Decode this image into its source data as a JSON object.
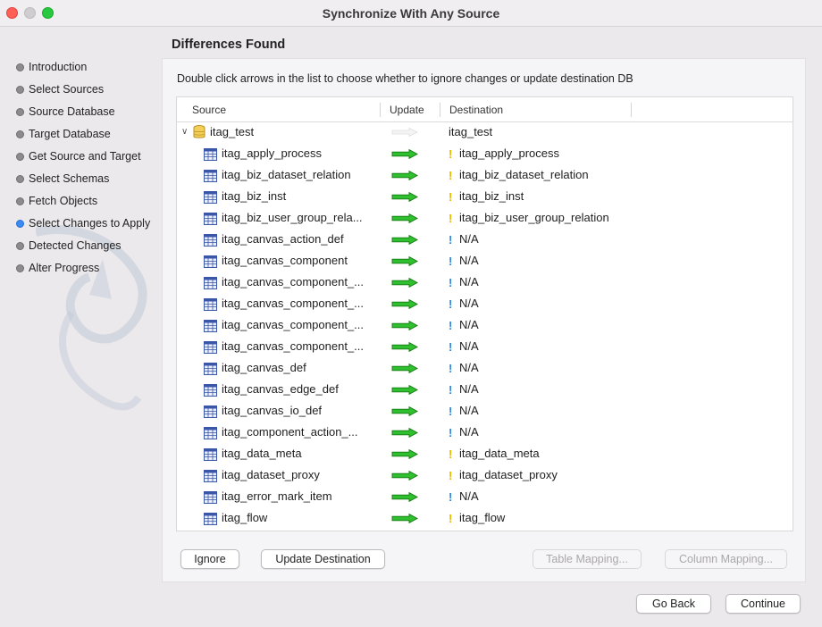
{
  "window": {
    "title": "Synchronize With Any Source"
  },
  "sidebar": {
    "steps": [
      {
        "label": "Introduction",
        "active": false
      },
      {
        "label": "Select Sources",
        "active": false
      },
      {
        "label": "Source Database",
        "active": false
      },
      {
        "label": "Target Database",
        "active": false
      },
      {
        "label": "Get Source and Target",
        "active": false
      },
      {
        "label": "Select Schemas",
        "active": false
      },
      {
        "label": "Fetch Objects",
        "active": false
      },
      {
        "label": "Select Changes to Apply",
        "active": true
      },
      {
        "label": "Detected Changes",
        "active": false
      },
      {
        "label": "Alter Progress",
        "active": false
      }
    ]
  },
  "main": {
    "heading": "Differences Found",
    "instruction": "Double click arrows in the list to choose whether to ignore changes or update destination DB",
    "columns": {
      "source": "Source",
      "update": "Update",
      "destination": "Destination"
    },
    "schema": {
      "source": "itag_test",
      "destination": "itag_test"
    },
    "rows": [
      {
        "source": "itag_apply_process",
        "status": "warn",
        "destination": "itag_apply_process"
      },
      {
        "source": "itag_biz_dataset_relation",
        "status": "warn",
        "destination": "itag_biz_dataset_relation"
      },
      {
        "source": "itag_biz_inst",
        "status": "warn",
        "destination": "itag_biz_inst"
      },
      {
        "source": "itag_biz_user_group_rela...",
        "status": "warn",
        "destination": "itag_biz_user_group_relation"
      },
      {
        "source": "itag_canvas_action_def",
        "status": "info",
        "destination": "N/A"
      },
      {
        "source": "itag_canvas_component",
        "status": "info",
        "destination": "N/A"
      },
      {
        "source": "itag_canvas_component_...",
        "status": "info",
        "destination": "N/A"
      },
      {
        "source": "itag_canvas_component_...",
        "status": "info",
        "destination": "N/A"
      },
      {
        "source": "itag_canvas_component_...",
        "status": "info",
        "destination": "N/A"
      },
      {
        "source": "itag_canvas_component_...",
        "status": "info",
        "destination": "N/A"
      },
      {
        "source": "itag_canvas_def",
        "status": "info",
        "destination": "N/A"
      },
      {
        "source": "itag_canvas_edge_def",
        "status": "info",
        "destination": "N/A"
      },
      {
        "source": "itag_canvas_io_def",
        "status": "info",
        "destination": "N/A"
      },
      {
        "source": "itag_component_action_...",
        "status": "info",
        "destination": "N/A"
      },
      {
        "source": "itag_data_meta",
        "status": "warn",
        "destination": "itag_data_meta"
      },
      {
        "source": "itag_dataset_proxy",
        "status": "warn",
        "destination": "itag_dataset_proxy"
      },
      {
        "source": "itag_error_mark_item",
        "status": "info",
        "destination": "N/A"
      },
      {
        "source": "itag_flow",
        "status": "warn",
        "destination": "itag_flow"
      }
    ],
    "buttons": {
      "ignore": "Ignore",
      "update_destination": "Update Destination",
      "table_mapping": "Table Mapping...",
      "column_mapping": "Column Mapping..."
    }
  },
  "footer": {
    "back": "Go Back",
    "continue": "Continue"
  },
  "colors": {
    "arrow": "#2fbf2f",
    "warn": "#e5b900",
    "info": "#2f8bd8",
    "active_step": "#3b8af6"
  }
}
